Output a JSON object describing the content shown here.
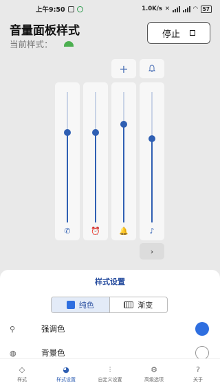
{
  "status": {
    "time": "上午9:50",
    "speed": "1.0K/s",
    "battery": "57"
  },
  "header": {
    "title": "音量面板样式",
    "subtitle": "当前样式："
  },
  "stop_button": {
    "label": "停止"
  },
  "sliders": [
    {
      "name": "call",
      "icon": "phone-icon",
      "glyph": "✆",
      "level": 0.69
    },
    {
      "name": "alarm",
      "icon": "alarm-clock-icon",
      "glyph": "⏰",
      "level": 0.69
    },
    {
      "name": "ring",
      "icon": "bell-icon",
      "glyph": "🔔",
      "level": 0.75
    },
    {
      "name": "media",
      "icon": "music-note-icon",
      "glyph": "♪",
      "level": 0.64
    }
  ],
  "sheet": {
    "title": "样式设置",
    "segments": [
      {
        "label": "纯色",
        "active": true
      },
      {
        "label": "渐变",
        "active": false
      }
    ],
    "rows": [
      {
        "label": "强调色",
        "color": "#2f6fe0"
      },
      {
        "label": "背景色",
        "color": "#ffffff"
      }
    ]
  },
  "nav": [
    {
      "label": "样式",
      "icon": "style-icon",
      "glyph": "◇",
      "active": false
    },
    {
      "label": "样式设置",
      "icon": "palette-icon",
      "glyph": "◕",
      "active": true
    },
    {
      "label": "自定义设置",
      "icon": "sliders-icon",
      "glyph": "⫶",
      "active": false
    },
    {
      "label": "高级选项",
      "icon": "gear-icon",
      "glyph": "⚙",
      "active": false
    },
    {
      "label": "关于",
      "icon": "help-icon",
      "glyph": "?",
      "active": false
    }
  ],
  "colors": {
    "accent": "#2f5fb3",
    "track": "#c9d3e6"
  }
}
